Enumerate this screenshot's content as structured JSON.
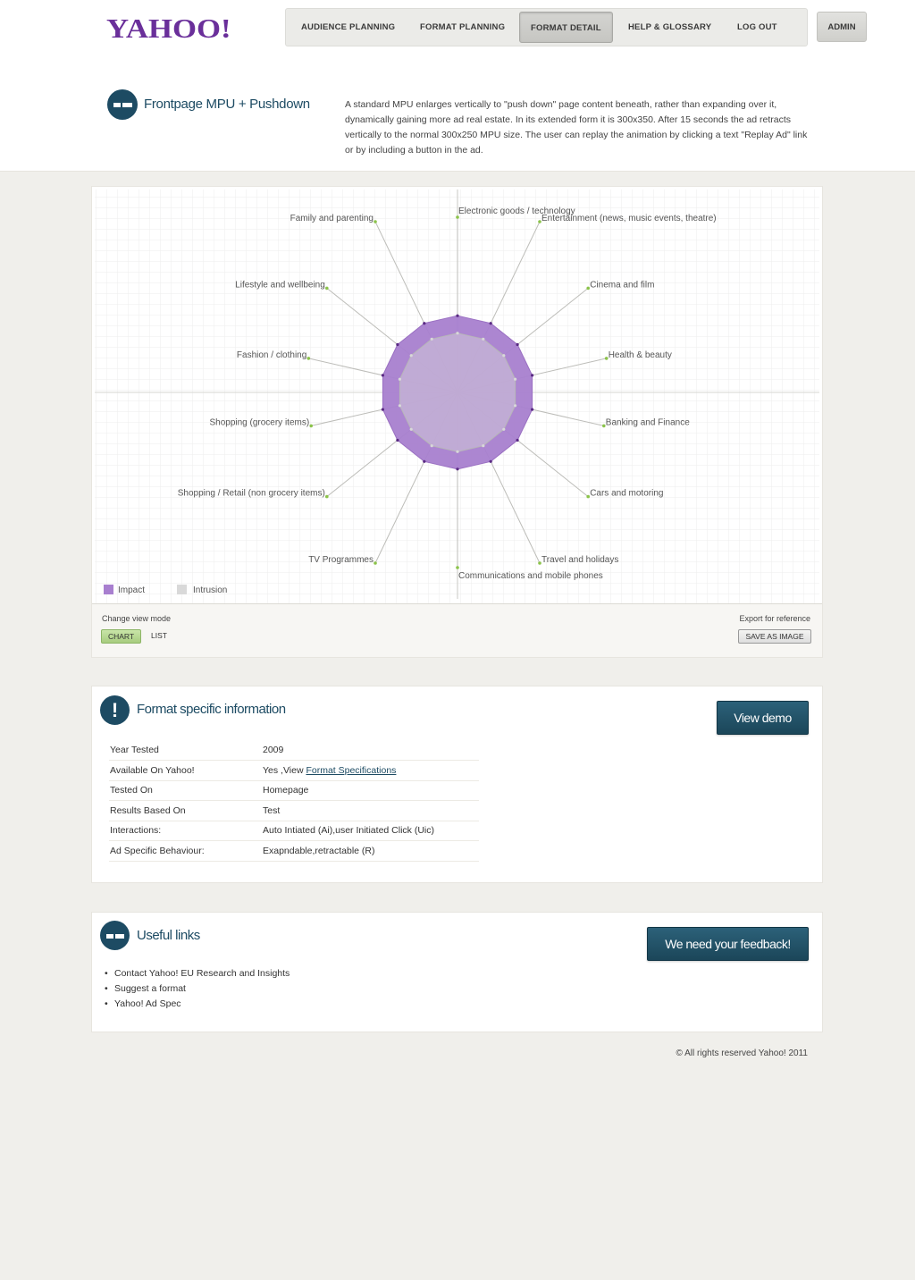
{
  "header": {
    "logo": "YAHOO!",
    "nav": [
      {
        "label": "AUDIENCE PLANNING"
      },
      {
        "label": "FORMAT PLANNING"
      },
      {
        "label": "FORMAT DETAIL"
      },
      {
        "label": "HELP & GLOSSARY"
      },
      {
        "label": "LOG OUT"
      }
    ],
    "admin_label": "ADMIN"
  },
  "format": {
    "title": "Frontpage MPU + Pushdown",
    "description": "A standard MPU enlarges vertically to \"push down\" page content beneath, rather than expanding over it, dynamically gaining more ad real estate. In its extended form it is 300x350. After 15 seconds the ad retracts vertically to the normal 300x250 MPU size. The user can replay the animation by clicking a text \"Replay Ad\" link or by including a button in the ad."
  },
  "chart_data": {
    "type": "radar",
    "categories": [
      "Electronic goods / technology",
      "Entertainment (news, music events, theatre)",
      "Cinema and film",
      "Health & beauty",
      "Banking and Finance",
      "Cars and motoring",
      "Travel and holidays",
      "Communications and mobile phones",
      "TV Programmes",
      "Shopping / Retail (non grocery items)",
      "Shopping (grocery items)",
      "Fashion / clothing",
      "Lifestyle and wellbeing",
      "Family and parenting"
    ],
    "series": [
      {
        "name": "Impact",
        "color": "#a87fcf",
        "values": [
          0.44,
          0.44,
          0.44,
          0.44,
          0.44,
          0.44,
          0.44,
          0.44,
          0.44,
          0.44,
          0.44,
          0.44,
          0.44,
          0.44
        ]
      },
      {
        "name": "Intrusion",
        "color": "#d9d9d9",
        "values": [
          0.34,
          0.34,
          0.34,
          0.34,
          0.34,
          0.34,
          0.34,
          0.34,
          0.34,
          0.34,
          0.34,
          0.34,
          0.34,
          0.34
        ]
      }
    ],
    "legend": "bottom-left",
    "grid": true
  },
  "chart_controls": {
    "view_mode_label": "Change view mode",
    "chart_button": "CHART",
    "list_button": "LIST",
    "export_label": "Export for reference",
    "save_button": "SAVE AS IMAGE"
  },
  "info": {
    "title": "Format specific information",
    "demo_button": "View demo",
    "rows": [
      {
        "key": "Year Tested",
        "value": "2009"
      },
      {
        "key": "Available On Yahoo!",
        "value": "Yes ,View ",
        "link": "Format Specifications"
      },
      {
        "key": "Tested On",
        "value": "Homepage"
      },
      {
        "key": "Results Based On",
        "value": "Test"
      },
      {
        "key": "Interactions:",
        "value": "Auto Intiated (Ai),user Initiated Click (Uic)"
      },
      {
        "key": "Ad Specific Behaviour:",
        "value": "Exapndable,retractable (R)"
      }
    ]
  },
  "links": {
    "title": "Useful links",
    "feedback_button": "We need your feedback!",
    "items": [
      "Contact Yahoo! EU Research and Insights",
      "Suggest a format",
      "Yahoo! Ad Spec"
    ]
  },
  "footer": {
    "copyright": "© All rights reserved Yahoo! 2011"
  }
}
